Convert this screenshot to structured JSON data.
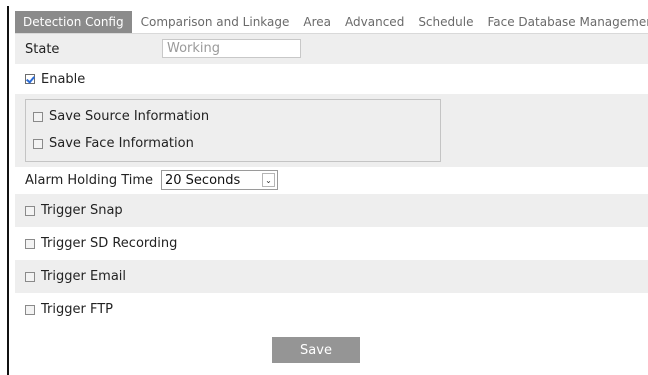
{
  "tabs": [
    "Detection Config",
    "Comparison and Linkage",
    "Area",
    "Advanced",
    "Schedule",
    "Face Database Management"
  ],
  "state": {
    "label": "State",
    "value": "Working"
  },
  "enable": {
    "label": "Enable",
    "checked": true
  },
  "save_options": [
    {
      "label": "Save Source Information",
      "checked": false
    },
    {
      "label": "Save Face Information",
      "checked": false
    }
  ],
  "alarm_holding": {
    "label": "Alarm Holding Time",
    "value": "20 Seconds"
  },
  "triggers": [
    {
      "label": "Trigger Snap",
      "checked": false
    },
    {
      "label": "Trigger SD Recording",
      "checked": false
    },
    {
      "label": "Trigger Email",
      "checked": false
    },
    {
      "label": "Trigger FTP",
      "checked": false
    }
  ],
  "save_button": "Save",
  "colors": {
    "active_tab": "#8b8b8b",
    "row_shade": "#eeeeee",
    "button": "#959595"
  }
}
